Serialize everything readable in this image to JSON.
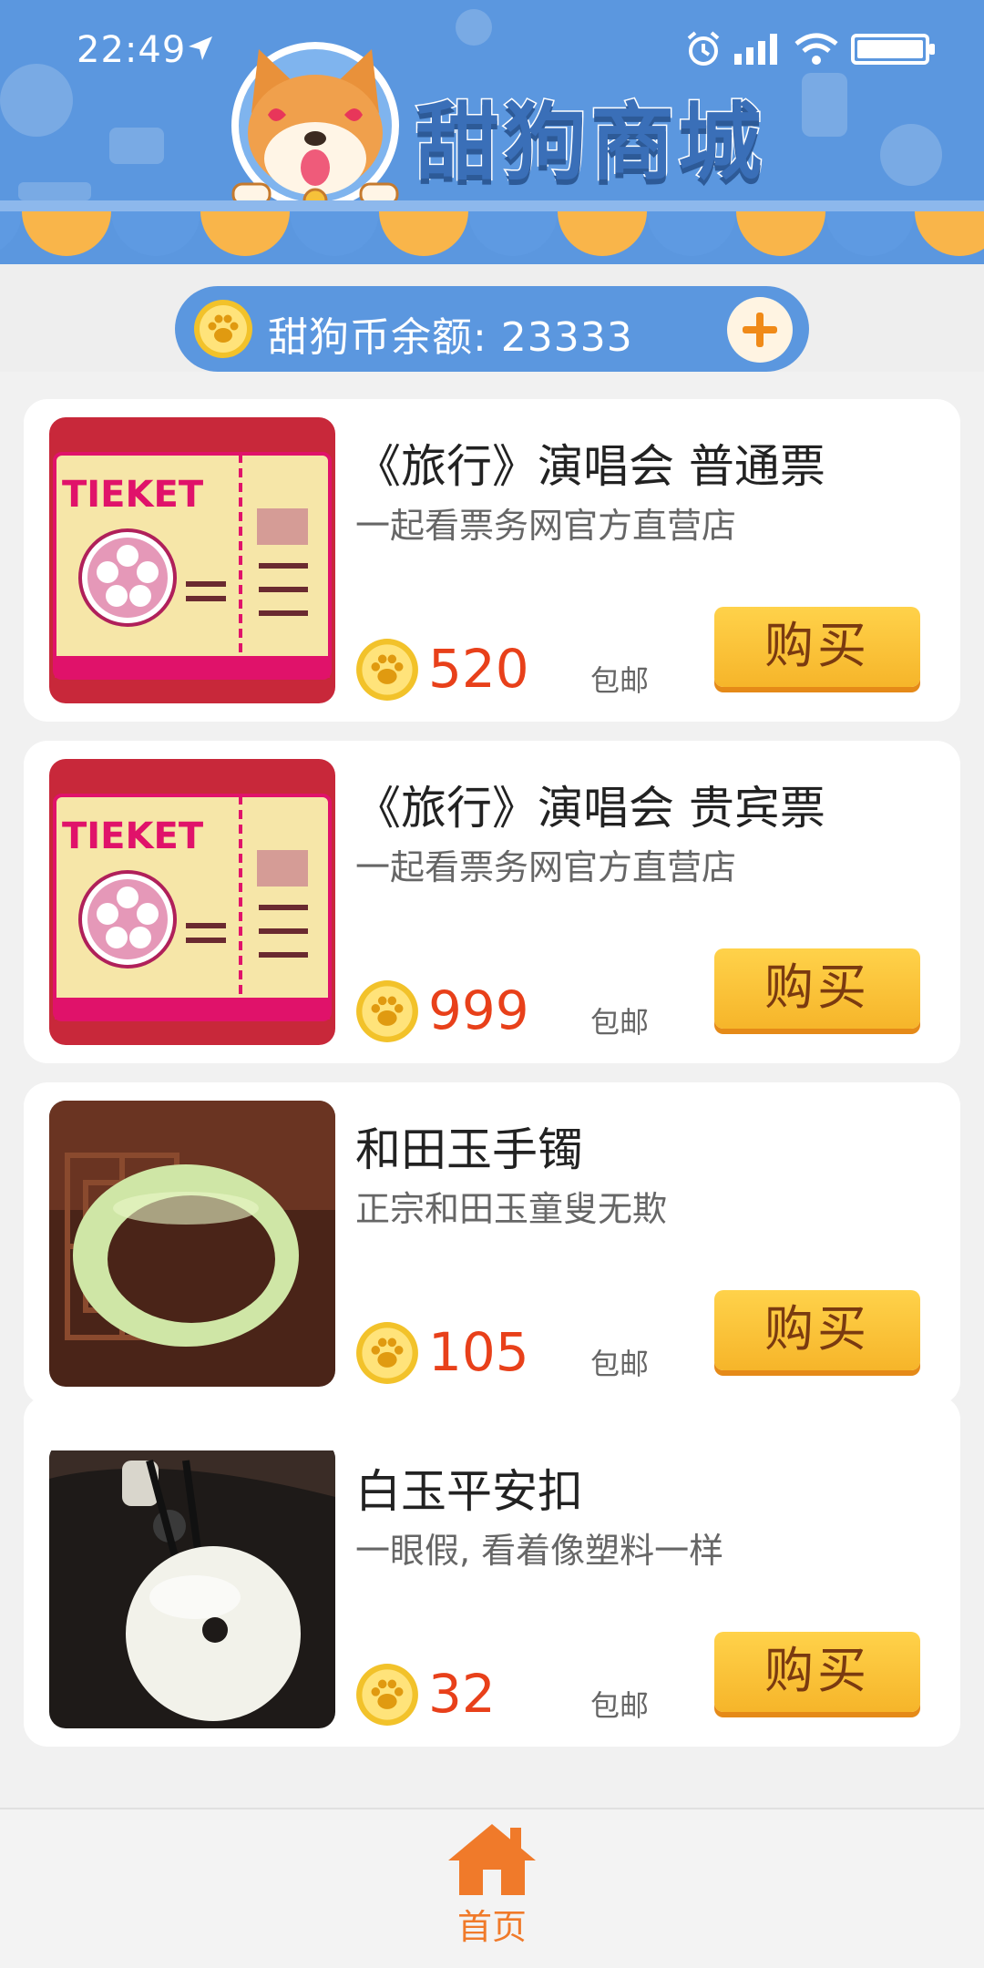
{
  "status": {
    "time": "22:49"
  },
  "header": {
    "title": "甜狗商城"
  },
  "balance": {
    "label": "甜狗币余额: 23333"
  },
  "products": [
    {
      "title": "《旅行》演唱会  普通票",
      "subtitle": "一起看票务网官方直营店",
      "price": "520",
      "shipping": "包邮",
      "buy": "购买",
      "image": "ticket-image"
    },
    {
      "title": "《旅行》演唱会  贵宾票",
      "subtitle": "一起看票务网官方直营店",
      "price": "999",
      "shipping": "包邮",
      "buy": "购买",
      "image": "ticket-image"
    },
    {
      "title": "和田玉手镯",
      "subtitle": "正宗和田玉童叟无欺",
      "price": "105",
      "shipping": "包邮",
      "buy": "购买",
      "image": "jade-bracelet-image"
    },
    {
      "title": "白玉平安扣",
      "subtitle": "一眼假, 看着像塑料一样",
      "price": "32",
      "shipping": "包邮",
      "buy": "购买",
      "image": "jade-pendant-image"
    }
  ],
  "nav": {
    "home": "首页"
  },
  "colors": {
    "header": "#5b97df",
    "accent": "#f07a2a",
    "price": "#e8401a",
    "buy": "#f6b52a"
  }
}
